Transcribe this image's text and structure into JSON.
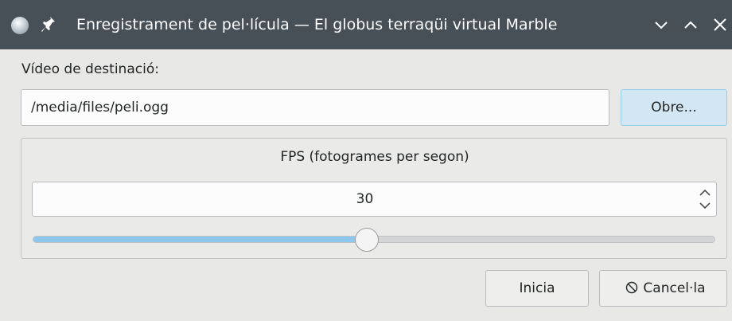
{
  "window": {
    "title": "Enregistrament de pel·lícula — El globus terraqüi virtual Marble",
    "icons": [
      "marble-app-icon",
      "pin-icon",
      "minimize-icon",
      "maximize-icon",
      "close-icon"
    ]
  },
  "destination": {
    "label": "Vídeo de destinació:",
    "path": "/media/files/peli.ogg",
    "open_label": "Obre..."
  },
  "fps": {
    "title": "FPS (fotogrames per segon)",
    "value": "30",
    "slider_fraction": 0.49
  },
  "actions": {
    "start_label": "Inicia",
    "cancel_label": "Cancel·la",
    "cancel_icon": "cancel-icon"
  },
  "colors": {
    "titlebar": "#475057",
    "accent": "#8cc8ee",
    "open_button": "#d2e6f3"
  }
}
